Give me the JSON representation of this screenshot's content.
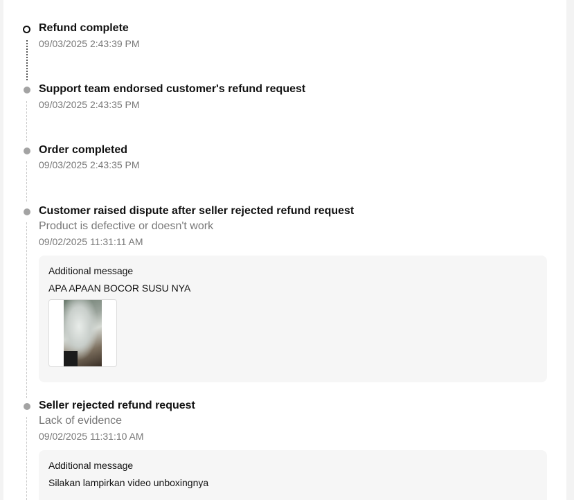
{
  "timeline": [
    {
      "title": "Refund complete",
      "time": "09/03/2025 2:43:39 PM",
      "current": true
    },
    {
      "title": "Support team endorsed customer's refund request",
      "time": "09/03/2025 2:43:35 PM"
    },
    {
      "title": "Order completed",
      "time": "09/03/2025 2:43:35 PM"
    },
    {
      "title": "Customer raised dispute after seller rejected refund request",
      "reason": "Product is defective or doesn't work",
      "time": "09/02/2025 11:31:11 AM",
      "message_label": "Additional message",
      "message_text": "APA APAAN BOCOR SUSU NYA",
      "attachment_icon": "photo-thumbnail"
    },
    {
      "title": "Seller rejected refund request",
      "reason": "Lack of evidence",
      "time": "09/02/2025 11:31:10 AM",
      "message_label": "Additional message",
      "message_text": "Silakan lampirkan video unboxingnya"
    }
  ]
}
